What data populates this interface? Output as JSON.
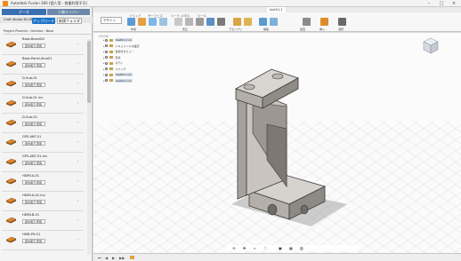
{
  "window": {
    "title": "Autodesk Fusion 360 (個人用 - 商業利用不可)"
  },
  "left_panel": {
    "tabs": [
      "データ",
      "人物メンバー"
    ],
    "team": "Craft Studio 3D DESIGN",
    "upload_label": "アップロード",
    "new_folder_label": "新規フォルダ",
    "breadcrumb": [
      "Project Phoenix",
      "Arduino",
      "Base"
    ],
    "files": [
      {
        "name": "Base-Board02",
        "badge": "読み取り専用"
      },
      {
        "name": "Base-Panel-Alue01",
        "badge": "読み取り専用"
      },
      {
        "name": "D-Sub-01",
        "badge": "読み取り専用"
      },
      {
        "name": "D-Sub-01 inv",
        "badge": "読み取り専用"
      },
      {
        "name": "D-Sub-02",
        "badge": "読み取り専用"
      },
      {
        "name": "GPS-ANT-01",
        "badge": "読み取り専用"
      },
      {
        "name": "GPS-ANT-01-inv",
        "badge": "読み取り専用"
      },
      {
        "name": "HDMI-A-01",
        "badge": "読み取り専用"
      },
      {
        "name": "HDMI-A-01-inv",
        "badge": "読み取り専用"
      },
      {
        "name": "HDMI-B-01",
        "badge": "読み取り専用"
      },
      {
        "name": "HMD-Pit-01",
        "badge": "読み取り専用"
      }
    ]
  },
  "toolbar": {
    "doc_tab": "test01-1",
    "workspace": "デザイン",
    "workspace_tabs": [
      "ソリッド",
      "サーフェス",
      "シート メタル",
      "ツール"
    ],
    "groups": [
      "作成",
      "修正",
      "アセンブリ",
      "構築",
      "検査",
      "挿入",
      "選択"
    ]
  },
  "browser": {
    "header": "ブラウザ",
    "rows": [
      "test01-1 v1",
      "ドキュメントの設定",
      "名前付きビュー",
      "原点",
      "ボディ",
      "スケッチ",
      "test01:1 v1",
      "test01:1 v1"
    ]
  },
  "colors": {
    "accent": "#1a73c8",
    "tab_active": "#3a6fb0",
    "tab_inactive": "#6d88aa",
    "part_fill": "#c9c4be",
    "part_edge": "#3a3a3a"
  }
}
